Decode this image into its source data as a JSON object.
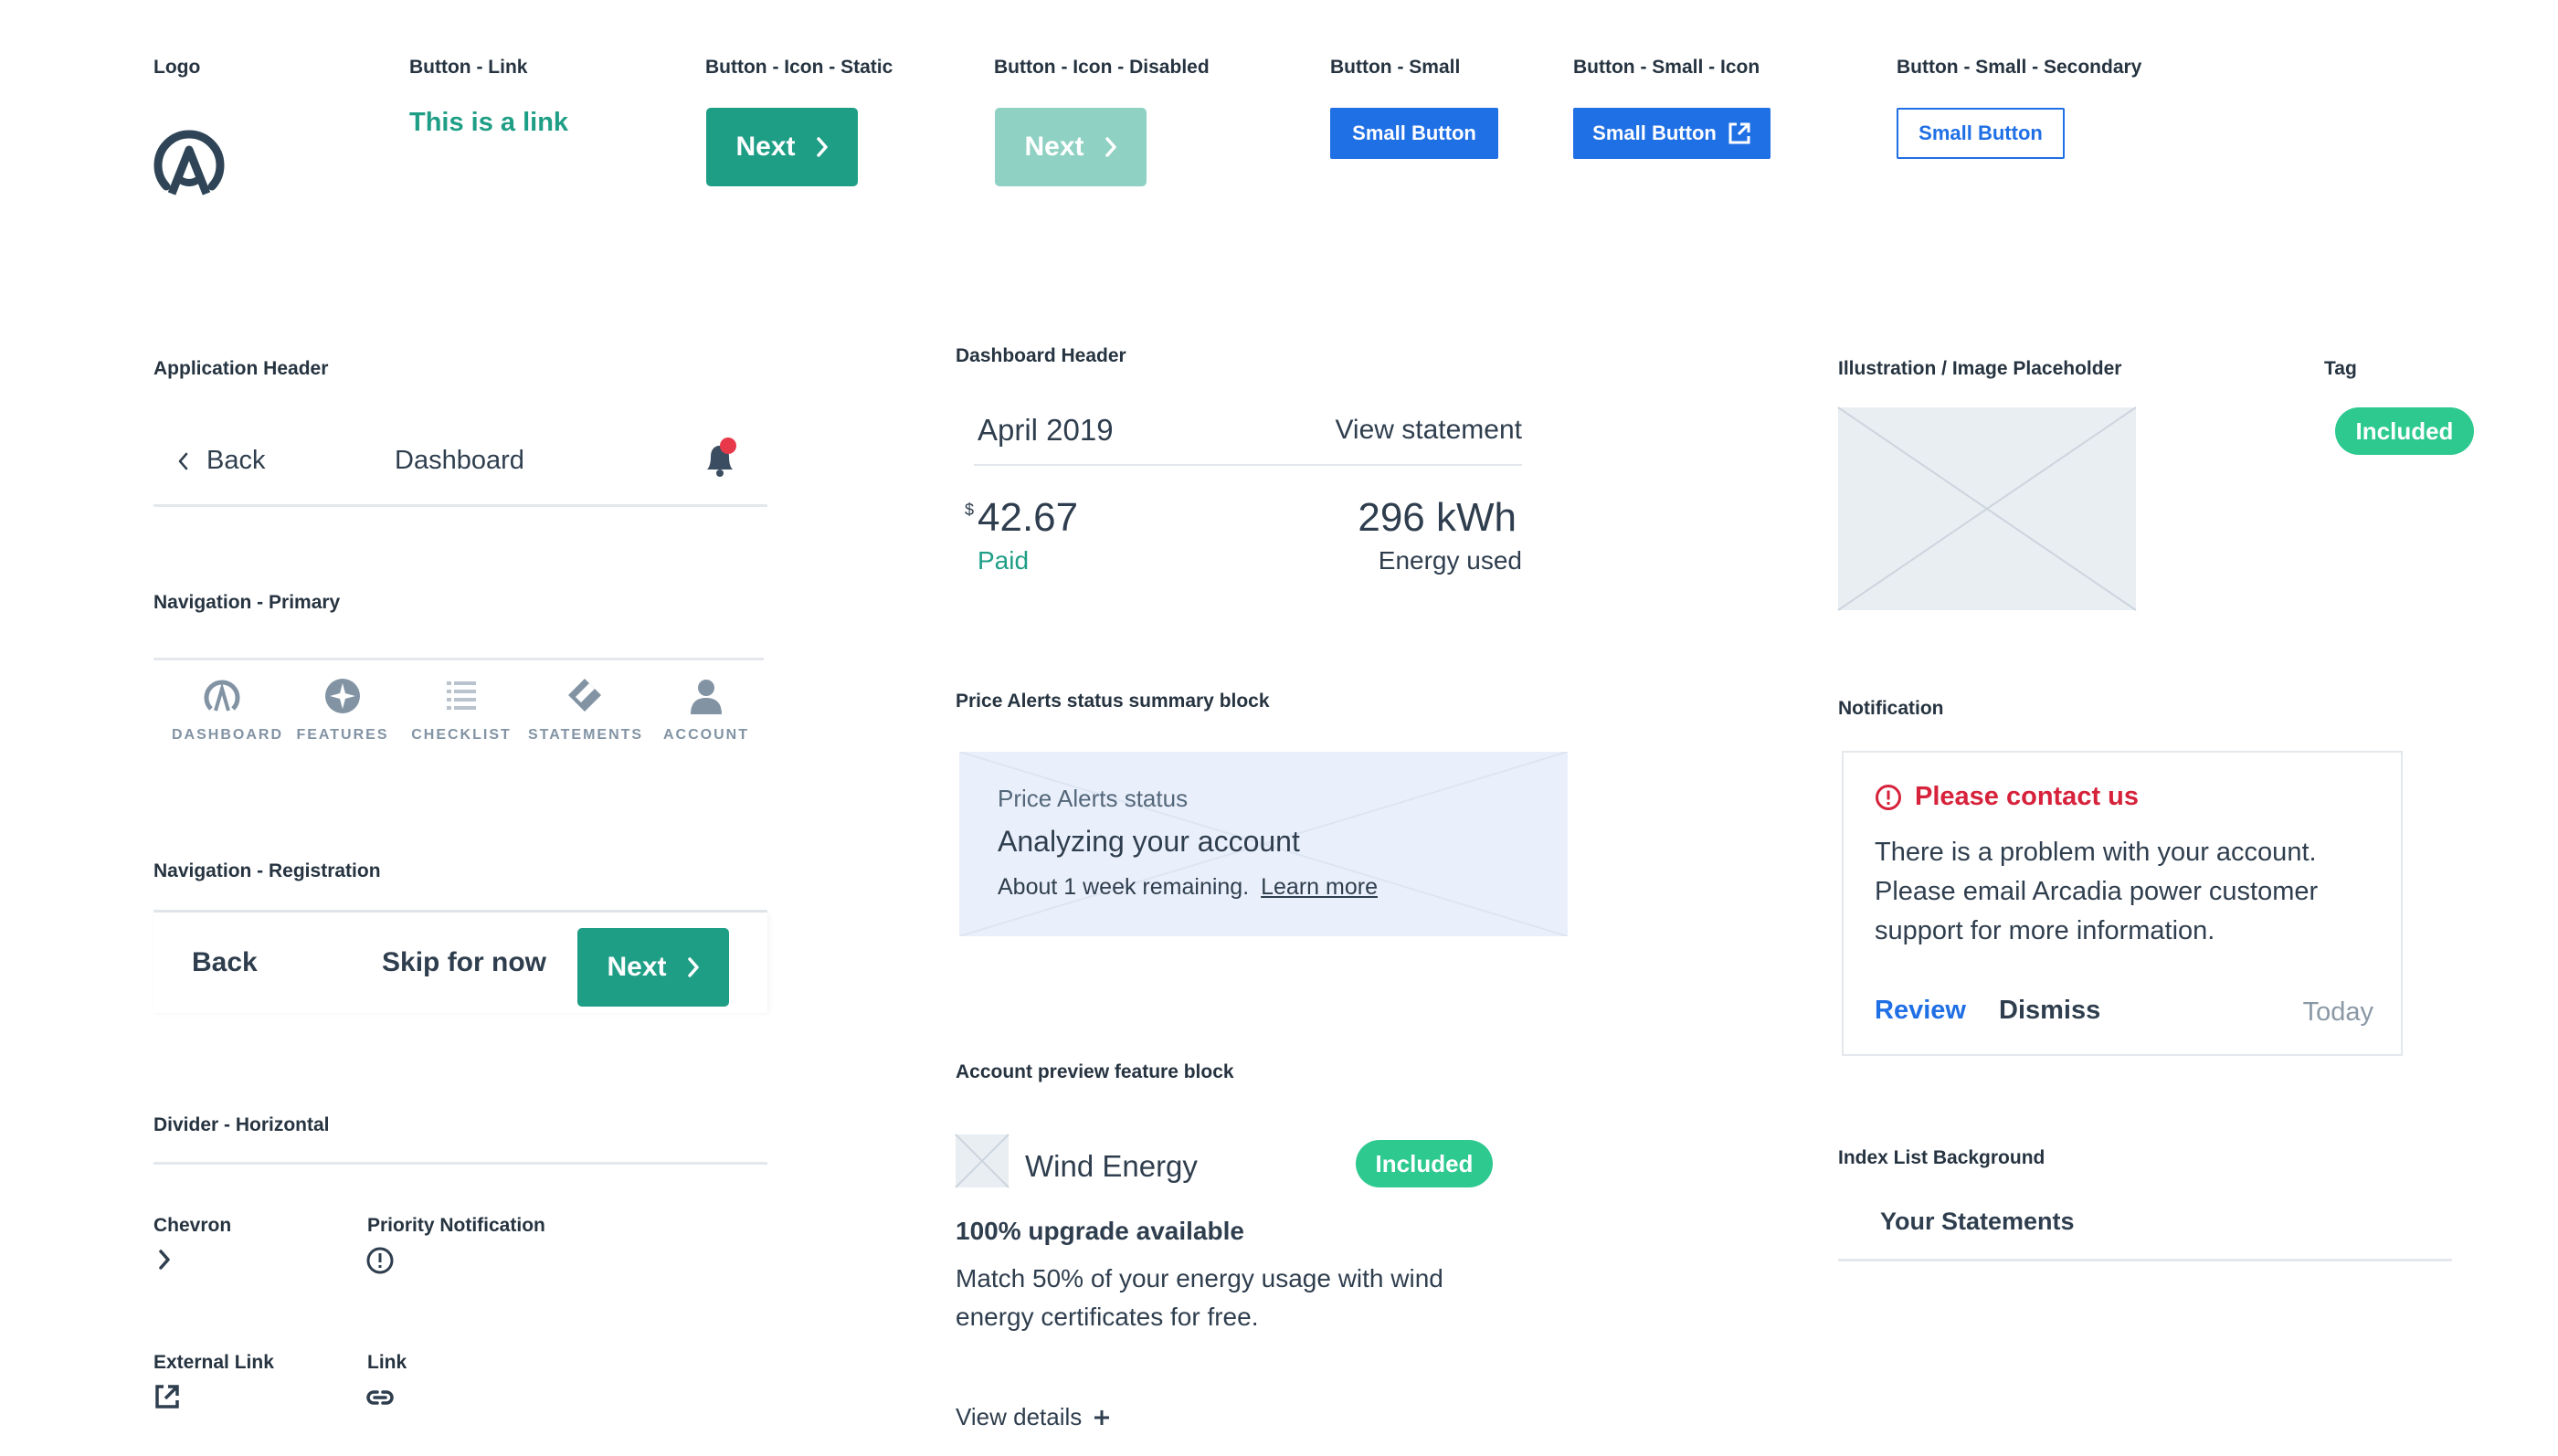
{
  "colors": {
    "primary_green": "#1f9e86",
    "disabled_green": "#8fd1c3",
    "blue": "#1f6fe5",
    "tag_green": "#2dc98f",
    "alert_red": "#d6223b",
    "text_dark": "#2f3e4e",
    "muted": "#8293a4"
  },
  "labels": {
    "logo": "Logo",
    "button_link": "Button - Link",
    "button_icon_static": "Button - Icon - Static",
    "button_icon_disabled": "Button - Icon - Disabled",
    "button_small": "Button - Small",
    "button_small_icon": "Button - Small - Icon",
    "button_small_secondary": "Button - Small - Secondary",
    "application_header": "Application Header",
    "dashboard_header": "Dashboard Header",
    "illustration_placeholder": "Illustration / Image Placeholder",
    "tag": "Tag",
    "navigation_primary": "Navigation - Primary",
    "price_alerts_block": "Price Alerts status summary block",
    "notification": "Notification",
    "navigation_registration": "Navigation - Registration",
    "account_preview_block": "Account preview feature block",
    "divider_horizontal": "Divider - Horizontal",
    "index_list_background": "Index List Background",
    "chevron": "Chevron",
    "priority_notification": "Priority Notification",
    "external_link": "External Link",
    "link": "Link"
  },
  "buttons": {
    "link_text": "This is a link",
    "next": "Next",
    "next_disabled": "Next",
    "small": "Small Button",
    "small_icon": "Small Button",
    "small_secondary": "Small Button"
  },
  "app_header": {
    "back": "Back",
    "title": "Dashboard",
    "icon": "bell-icon"
  },
  "dashboard_header": {
    "month": "April 2019",
    "view_statement": "View statement",
    "currency": "$",
    "amount": "42.67",
    "status": "Paid",
    "energy": "296 kWh",
    "energy_label": "Energy used"
  },
  "tag": {
    "text": "Included"
  },
  "nav_primary": {
    "items": [
      {
        "label": "DASHBOARD",
        "icon": "dashboard-icon"
      },
      {
        "label": "FEATURES",
        "icon": "features-icon"
      },
      {
        "label": "CHECKLIST",
        "icon": "checklist-icon"
      },
      {
        "label": "STATEMENTS",
        "icon": "statements-icon"
      },
      {
        "label": "ACCOUNT",
        "icon": "account-icon"
      }
    ]
  },
  "price_alerts": {
    "title": "Price Alerts status",
    "heading": "Analyzing your account",
    "remaining": "About 1 week remaining.",
    "learn_more": "Learn more"
  },
  "notification": {
    "title": "Please contact us",
    "line1": "There is a problem with your account.",
    "line2": "Please email Arcadia power customer",
    "line3": "support for more information.",
    "review": "Review",
    "dismiss": "Dismiss",
    "time": "Today"
  },
  "nav_registration": {
    "back": "Back",
    "skip": "Skip for now",
    "next": "Next"
  },
  "account_preview": {
    "title": "Wind Energy",
    "tag": "Included",
    "upgrade": "100% upgrade available",
    "desc1": "Match 50% of your energy usage with wind",
    "desc2": "energy certificates for free.",
    "view_details": "View details"
  },
  "index_list": {
    "item": "Your Statements"
  }
}
